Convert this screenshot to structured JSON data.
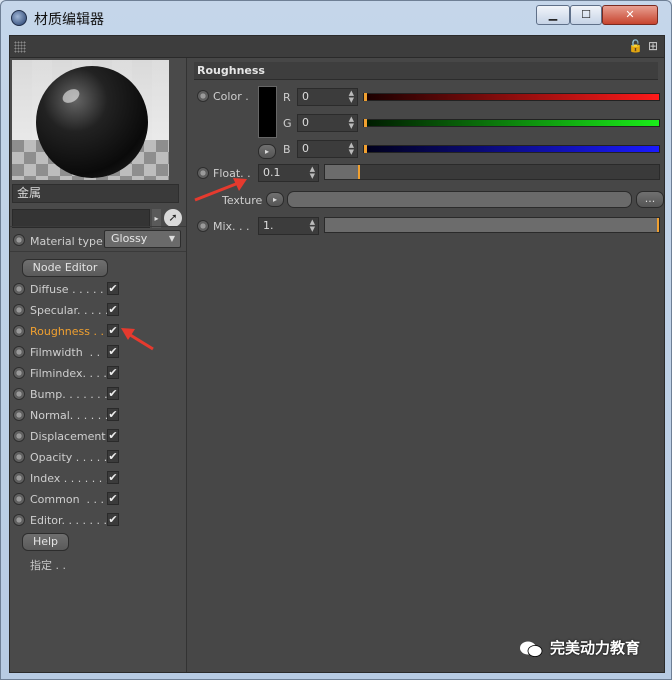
{
  "window": {
    "title": "材质编辑器",
    "min_glyph": "▁",
    "max_glyph": "☐",
    "close_glyph": "✕"
  },
  "toolbar": {
    "lock_icon": "🔓",
    "add_icon": "⊞"
  },
  "left": {
    "material_name": "金属",
    "material_type_label": "Material type",
    "material_type_value": "Glossy",
    "node_editor_label": "Node Editor",
    "help_label": "Help",
    "assign_label": "指定 . .",
    "channels": [
      {
        "label": "Diffuse . . . . . .",
        "checked": "✔"
      },
      {
        "label": "Specular. . . . .",
        "checked": "✔"
      },
      {
        "label": "Roughness . .",
        "checked": "✔"
      },
      {
        "label": "Filmwidth  . .",
        "checked": "✔"
      },
      {
        "label": "Filmindex. . . .",
        "checked": "✔"
      },
      {
        "label": "Bump. . . . . . .",
        "checked": "✔"
      },
      {
        "label": "Normal. . . . . .",
        "checked": "✔"
      },
      {
        "label": "Displacement",
        "checked": "✔"
      },
      {
        "label": "Opacity . . . . .",
        "checked": "✔"
      },
      {
        "label": "Index . . . . . . .",
        "checked": "✔"
      },
      {
        "label": "Common  . . . .",
        "checked": "✔"
      },
      {
        "label": "Editor. . . . . . .",
        "checked": "✔"
      }
    ],
    "active_channel_color": "#f0a030"
  },
  "right": {
    "section_title": "Roughness",
    "color_label": "Color .",
    "r_label": "R",
    "g_label": "G",
    "b_label": "B",
    "r_value": "0",
    "g_value": "0",
    "b_value": "0",
    "float_label": "Float. .",
    "float_value": "0.1",
    "float_fraction": 0.1,
    "texture_label": "Texture",
    "texture_dots": "...",
    "mix_label": "Mix. . .",
    "mix_value": "1.",
    "mix_fraction": 1.0
  },
  "watermark": "完美动力教育"
}
